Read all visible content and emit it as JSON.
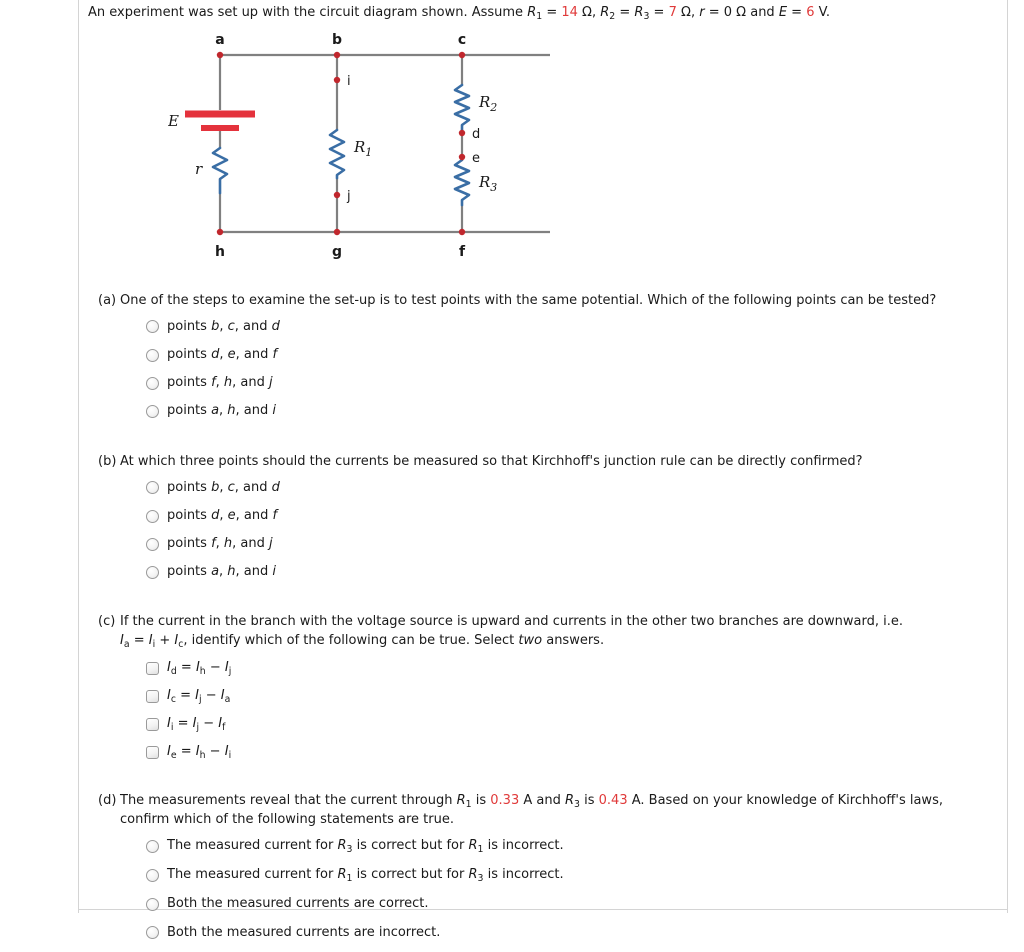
{
  "intro": {
    "text_before": "An experiment was set up with the circuit diagram shown. Assume ",
    "r1_symbol": "R",
    "r1_sub": "1",
    "eq1": " = ",
    "r1_value": "14",
    "unit_ohm": " Ω, ",
    "r2_symbol": "R",
    "r2_sub": "2",
    "eq2": " = ",
    "r3_symbol": "R",
    "r3_sub": "3",
    "eq3": " = ",
    "r23_value": "7",
    "unit_ohm2": " Ω, ",
    "r_symbol": "r",
    "eq4": " = ",
    "r_value": "0",
    "unit_ohm3": " Ω and ",
    "e_symbol": "E",
    "eq5": " = ",
    "e_value": "6",
    "unit_volt": " V."
  },
  "circuit": {
    "nodes": {
      "a": "a",
      "b": "b",
      "c": "c",
      "d": "d",
      "e": "e",
      "f": "f",
      "g": "g",
      "h": "h",
      "i": "i",
      "j": "j"
    },
    "components": {
      "source_label": "E",
      "internal_resistance_label": "r",
      "r1_label": "R",
      "r1_sub": "1",
      "r2_label": "R",
      "r2_sub": "2",
      "r3_label": "R",
      "r3_sub": "3"
    },
    "colors": {
      "wire": "#808080",
      "node": "#c0272d",
      "resistor": "#3a6ea5",
      "battery": "#e4323c",
      "label": "#1a1a1a"
    }
  },
  "questions": [
    {
      "letter": "(a)",
      "prompt": "One of the steps to examine the set-up is to test points with the same potential. Which of the following points can be tested?",
      "input_type": "radio",
      "options": [
        {
          "prefix": "points ",
          "items": [
            "b",
            "c"
          ],
          "tail_join": ", and ",
          "last": "d"
        },
        {
          "prefix": "points ",
          "items": [
            "d",
            "e"
          ],
          "tail_join": ", and ",
          "last": "f"
        },
        {
          "prefix": "points ",
          "items": [
            "f",
            "h"
          ],
          "tail_join": ", and ",
          "last": "j"
        },
        {
          "prefix": "points ",
          "items": [
            "a",
            "h"
          ],
          "tail_join": ", and ",
          "last": "i"
        }
      ]
    },
    {
      "letter": "(b)",
      "prompt": "At which three points should the currents be measured so that Kirchhoff's junction rule can be directly confirmed?",
      "input_type": "radio",
      "options": [
        {
          "prefix": "points ",
          "items": [
            "b",
            "c"
          ],
          "tail_join": ", and ",
          "last": "d"
        },
        {
          "prefix": "points ",
          "items": [
            "d",
            "e"
          ],
          "tail_join": ", and ",
          "last": "f"
        },
        {
          "prefix": "points ",
          "items": [
            "f",
            "h"
          ],
          "tail_join": ", and ",
          "last": "j"
        },
        {
          "prefix": "points ",
          "items": [
            "a",
            "h"
          ],
          "tail_join": ", and ",
          "last": "i"
        }
      ]
    },
    {
      "letter": "(c)",
      "prompt_line1": "If the current in the branch with the voltage source is upward and currents in the other two branches are downward, i.e.",
      "prompt_line2_pre": "",
      "prompt_line2_eq": "I a = I i + I c",
      "prompt_line2_post": ", identify which of the following can be true. Select ",
      "prompt_line2_em": "two",
      "prompt_line2_end": " answers.",
      "input_type": "checkbox",
      "equations": [
        {
          "lhs_sym": "I",
          "lhs_sub": "d",
          "op1": " = ",
          "a_sym": "I",
          "a_sub": "h",
          "op2": " − ",
          "b_sym": "I",
          "b_sub": "j"
        },
        {
          "lhs_sym": "I",
          "lhs_sub": "c",
          "op1": " = ",
          "a_sym": "I",
          "a_sub": "j",
          "op2": " − ",
          "b_sym": "I",
          "b_sub": "a"
        },
        {
          "lhs_sym": "I",
          "lhs_sub": "i",
          "op1": " = ",
          "a_sym": "I",
          "a_sub": "j",
          "op2": " − ",
          "b_sym": "I",
          "b_sub": "f"
        },
        {
          "lhs_sym": "I",
          "lhs_sub": "e",
          "op1": " = ",
          "a_sym": "I",
          "a_sub": "h",
          "op2": " − ",
          "b_sym": "I",
          "b_sub": "i"
        }
      ]
    },
    {
      "letter": "(d)",
      "prompt_pre": "The measurements reveal that the current through ",
      "prompt_r1": "R",
      "prompt_r1_sub": "1",
      "prompt_mid1": " is ",
      "current_r1": "0.33",
      "prompt_mid2": " A and ",
      "prompt_r3": "R",
      "prompt_r3_sub": "3",
      "prompt_mid3": " is ",
      "current_r3": "0.43",
      "prompt_mid4": " A. Based on your knowledge of Kirchhoff's laws,",
      "prompt_line2": "confirm which of the following statements are true.",
      "input_type": "radio",
      "options": [
        {
          "pre": "The measured current for ",
          "sym1": "R",
          "sub1": "3",
          "mid": " is correct but for ",
          "sym2": "R",
          "sub2": "1",
          "post": " is incorrect."
        },
        {
          "pre": "The measured current for ",
          "sym1": "R",
          "sub1": "1",
          "mid": " is correct but for ",
          "sym2": "R",
          "sub2": "3",
          "post": " is incorrect."
        },
        {
          "plain": "Both the measured currents are correct."
        },
        {
          "plain": "Both the measured currents are incorrect."
        }
      ]
    }
  ]
}
